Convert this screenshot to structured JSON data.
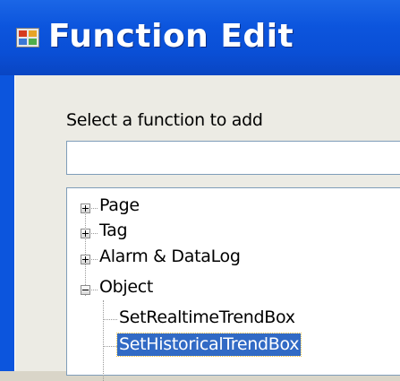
{
  "window": {
    "title": "Function Edit",
    "icon": "app-icon"
  },
  "main": {
    "prompt": "Select a function to add",
    "search": {
      "value": "",
      "placeholder": ""
    }
  },
  "tree": {
    "nodes": [
      {
        "label": "Page",
        "expanded": false
      },
      {
        "label": "Tag",
        "expanded": false
      },
      {
        "label": "Alarm & DataLog",
        "expanded": false
      },
      {
        "label": "Object",
        "expanded": true,
        "children": [
          {
            "label": "SetRealtimeTrendBox",
            "selected": false
          },
          {
            "label": "SetHistoricalTrendBox",
            "selected": true
          }
        ]
      }
    ]
  },
  "colors": {
    "titlebar": "#0c55dd",
    "selection": "#316ac5"
  }
}
